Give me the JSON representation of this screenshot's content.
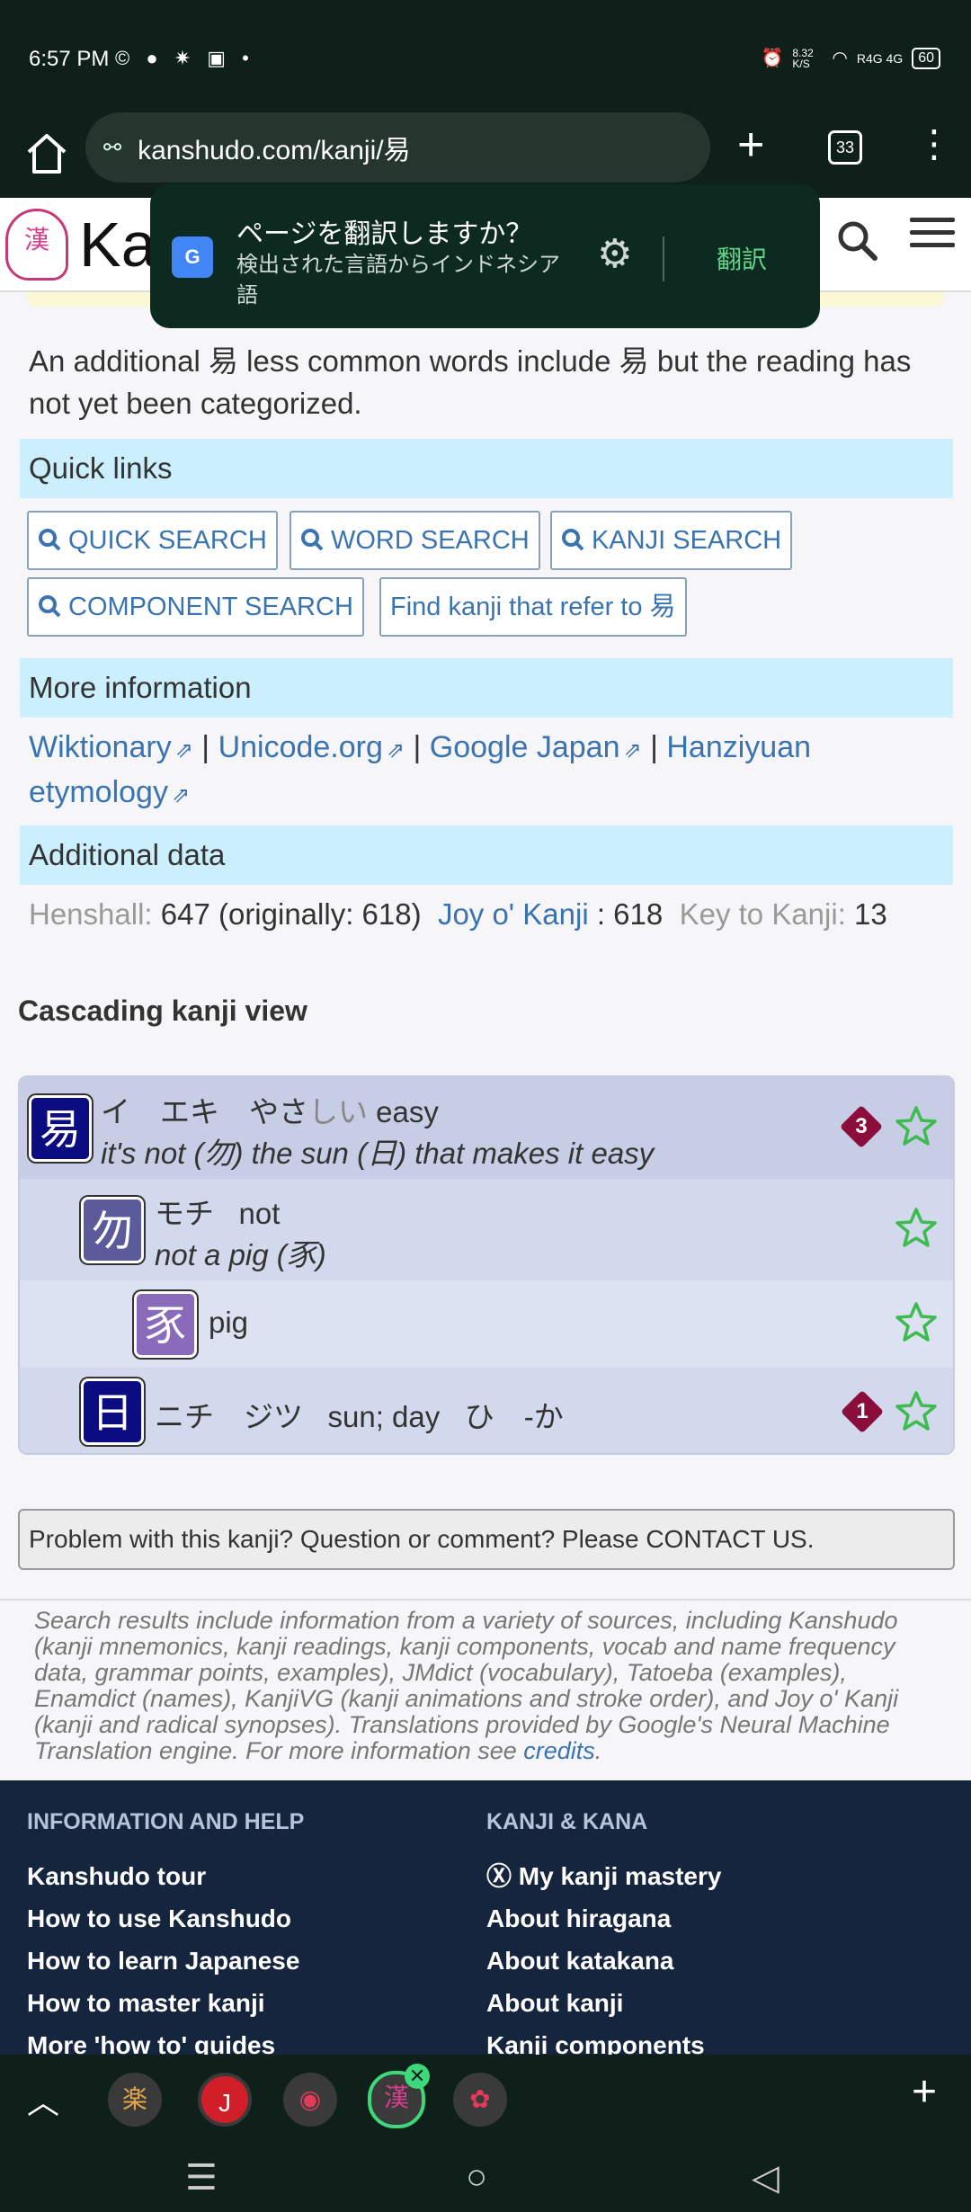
{
  "status_bar": {
    "time": "6:57 PM",
    "app_icons": "© ● ✷ ▣ •",
    "speed": "8.32 K/S",
    "network": "R4G 4G",
    "battery": "60"
  },
  "browser": {
    "url": "kanshudo.com/kanji/易",
    "tab_count": "33"
  },
  "site": {
    "logo_kanji": "漢",
    "logo_text": "Ka"
  },
  "translate_popup": {
    "title": "ページを翻訳しますか？",
    "subtitle": "検出された言語からインドネシア語",
    "translate_button": "翻訳",
    "google_icon_letter": "G"
  },
  "intro_text": "An additional 易 less common words include 易 but the reading has not yet been categorized.",
  "quick_links": {
    "heading": "Quick links",
    "buttons": [
      "QUICK SEARCH",
      "WORD SEARCH",
      "KANJI SEARCH",
      "COMPONENT SEARCH"
    ],
    "refer_button": "Find kanji that refer to 易"
  },
  "more_info": {
    "heading": "More information",
    "links": [
      "Wiktionary",
      "Unicode.org",
      "Google Japan",
      "Hanziyuan etymology"
    ],
    "separator": "|",
    "ext_symbol": "⇗"
  },
  "additional_data": {
    "heading": "Additional data",
    "henshall_label": "Henshall:",
    "henshall_value": "647 (originally: 618)",
    "joy_label": "Joy o' Kanji",
    "joy_value": ": 618",
    "key_label": "Key to Kanji:",
    "key_value": "13"
  },
  "cascade": {
    "title": "Cascading kanji view",
    "rows": [
      {
        "kanji": "易",
        "readings": "イ　エキ　やさ",
        "okurigana": "しい",
        "meaning": "easy",
        "mnemonic": "it's not (勿) the sun (日) that makes it easy",
        "badge": "3",
        "color": "#0b0b82"
      },
      {
        "kanji": "勿",
        "readings": "モチ",
        "meaning": "not",
        "mnemonic": "not a pig (豕)",
        "color": "#5b5b9c"
      },
      {
        "kanji": "豕",
        "meaning": "pig",
        "color": "#8a6bbb"
      },
      {
        "kanji": "日",
        "readings": "ニチ　ジツ",
        "meaning": "sun; day",
        "extra": "ひ　-か",
        "badge": "1",
        "color": "#0b0b82"
      }
    ]
  },
  "problem_text": "Problem with this kanji? Question or comment? Please CONTACT US.",
  "sources_text": "Search results include information from a variety of sources, including Kanshudo (kanji mnemonics, kanji readings, kanji components, vocab and name frequency data, grammar points, examples), JMdict (vocabulary), Tatoeba (examples), Enamdict (names), KanjiVG (kanji animations and stroke order), and Joy o' Kanji (kanji and radical synopses). Translations provided by Google's Neural Machine Translation engine. For more information see",
  "sources_link": "credits",
  "footer": {
    "col1_heading": "INFORMATION AND HELP",
    "col1_items": [
      "Kanshudo tour",
      "How to use Kanshudo",
      "How to learn Japanese",
      "How to master kanji",
      "More 'how to' guides"
    ],
    "col2_heading": "KANJI & KANA",
    "col2_items": [
      "Ⓧ My kanji mastery",
      "About hiragana",
      "About katakana",
      "About kanji",
      "Kanji components"
    ]
  },
  "tab_strip": {
    "tabs": [
      "楽",
      "J",
      "◉",
      "漢",
      "✿"
    ]
  },
  "colors": {
    "accent_blue": "#3a73b0",
    "section_bg": "#cbeffc",
    "footer_bg": "#15253d",
    "badge": "#8b0d3b",
    "star": "#3dbb4e"
  }
}
